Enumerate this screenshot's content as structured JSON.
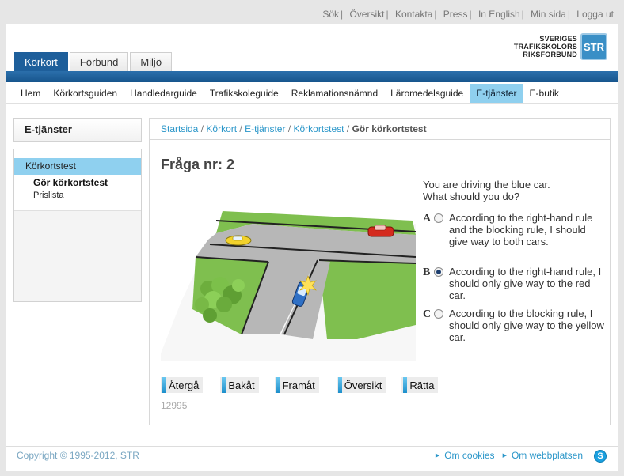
{
  "top_links": [
    "Sök",
    "Översikt",
    "Kontakta",
    "Press",
    "In English",
    "Min sida",
    "Logga ut"
  ],
  "logo": {
    "line1": "SVERIGES",
    "line2": "TRAFIKSKOLORS",
    "line3": "RIKSFÖRBUND",
    "badge": "STR"
  },
  "tabs": [
    {
      "label": "Körkort",
      "active": true
    },
    {
      "label": "Förbund",
      "active": false
    },
    {
      "label": "Miljö",
      "active": false
    }
  ],
  "main_nav": [
    "Hem",
    "Körkortsguiden",
    "Handledarguide",
    "Trafikskoleguide",
    "Reklamationsnämnd",
    "Läromedelsguide",
    "E-tjänster",
    "E-butik"
  ],
  "main_nav_active": "E-tjänster",
  "sidebar": {
    "title": "E-tjänster",
    "section": "Körkortstest",
    "items": [
      "Gör körkortstest",
      "Prislista"
    ]
  },
  "breadcrumb": {
    "items": [
      "Startsida",
      "Körkort",
      "E-tjänster",
      "Körkortstest"
    ],
    "current": "Gör körkortstest",
    "separator": "/"
  },
  "question": {
    "title": "Fråga nr: 2",
    "prompt_line1": "You are driving the blue car.",
    "prompt_line2": "What should you do?",
    "answers": [
      {
        "letter": "A",
        "text": "According to the right-hand rule and the blocking rule, I should give way to both cars.",
        "selected": false
      },
      {
        "letter": "B",
        "text": "According to the right-hand rule, I should only give way to the red car.",
        "selected": true
      },
      {
        "letter": "C",
        "text": "According to the blocking rule, I should only give way to the yellow car.",
        "selected": false
      }
    ],
    "id": "12995"
  },
  "buttons": [
    "Återgå",
    "Bakåt",
    "Framåt",
    "Översikt",
    "Rätta"
  ],
  "footer": {
    "copyright": "Copyright © 1995-2012, STR",
    "links": [
      "Om cookies",
      "Om webbplatsen"
    ]
  },
  "colors": {
    "brand_blue": "#1e5f9b",
    "highlight": "#8fd0ef",
    "link": "#2a96c9"
  },
  "icons": {
    "footer_arrow": "triangle-right-icon",
    "skype": "skype-icon",
    "radio": "radio-icon"
  }
}
